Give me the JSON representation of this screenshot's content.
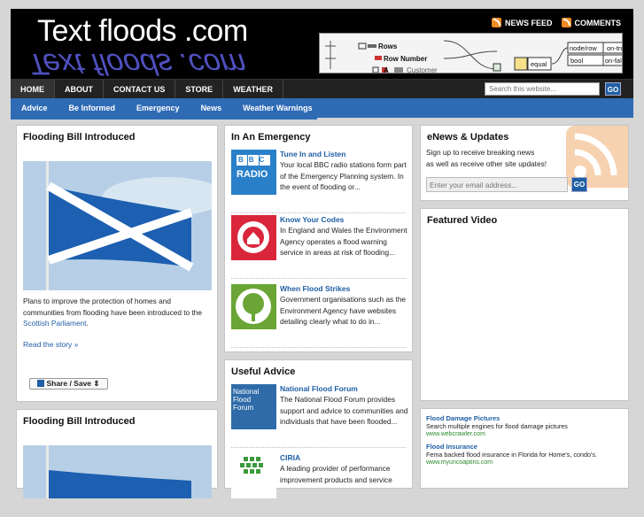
{
  "site": {
    "title": "Text floods .com"
  },
  "feeds": [
    {
      "label": "NEWS FEED"
    },
    {
      "label": "COMMENTS"
    }
  ],
  "banner": {
    "rows": "Rows",
    "row_number": "Row Number",
    "a": "A",
    "customer": "Customer",
    "equal": "equal",
    "node_row": "node/row",
    "on_true": "on-true",
    "bool": "bool",
    "on_false": "on-false"
  },
  "nav_primary": [
    "HOME",
    "ABOUT",
    "CONTACT US",
    "STORE",
    "WEATHER"
  ],
  "search": {
    "placeholder": "Search this website...",
    "go": "GO"
  },
  "nav_secondary": [
    "Advice",
    "Be Informed",
    "Emergency",
    "News",
    "Weather Warnings"
  ],
  "left": {
    "post1": {
      "title": "Flooding Bill Introduced",
      "text1": "Plans to improve the protection of homes and communities from flooding have been introduced to the ",
      "link": "Scottish Parliament",
      "text2": ".",
      "read_more": "Read the story »",
      "share": "Share / Save"
    },
    "post2": {
      "title": "Flooding Bill Introduced"
    }
  },
  "emergency": {
    "title": "In An Emergency",
    "items": [
      {
        "title": "Tune In and Listen",
        "text": "Your local BBC radio stations form part of the Emergency Planning system. In the event of flooding or...",
        "thumb_text": [
          "BBC",
          "RADIO"
        ]
      },
      {
        "title": "Know Your Codes",
        "text": "In England and Wales the Environment Agency operates a flood warning service in areas at risk of flooding..."
      },
      {
        "title": "When Flood Strikes",
        "text": "Government organisations such as the Environment Agency have websites detailing clearly what to do in..."
      }
    ]
  },
  "advice": {
    "title": "Useful Advice",
    "items": [
      {
        "title": "National Flood Forum",
        "text": "The National Flood Forum provides support and advice to communities and individuals that have been flooded...",
        "thumb_text": [
          "National",
          "Flood",
          "Forum"
        ]
      },
      {
        "title": "CIRIA",
        "text": "A leading provider of performance improvement products and service"
      }
    ]
  },
  "enews": {
    "title": "eNews & Updates",
    "text1": "Sign up to receive breaking news",
    "text2": "as well as receive other site updates!",
    "placeholder": "Enter your email address...",
    "go": "GO"
  },
  "video": {
    "title": "Featured Video"
  },
  "ads": [
    {
      "title": "Flood Damage Pictures",
      "desc": "Search multiple engines for flood damage pictures",
      "url": "www.webcrawler.com"
    },
    {
      "title": "Flood Insurance",
      "desc": "Fema backed flood insurance in Florida for Home's, condo's.",
      "url": "www.myuncoaptins.com"
    }
  ],
  "colors": {
    "accent": "#2f6bb5",
    "rss": "#f08a24",
    "nav_dark": "#222222"
  }
}
